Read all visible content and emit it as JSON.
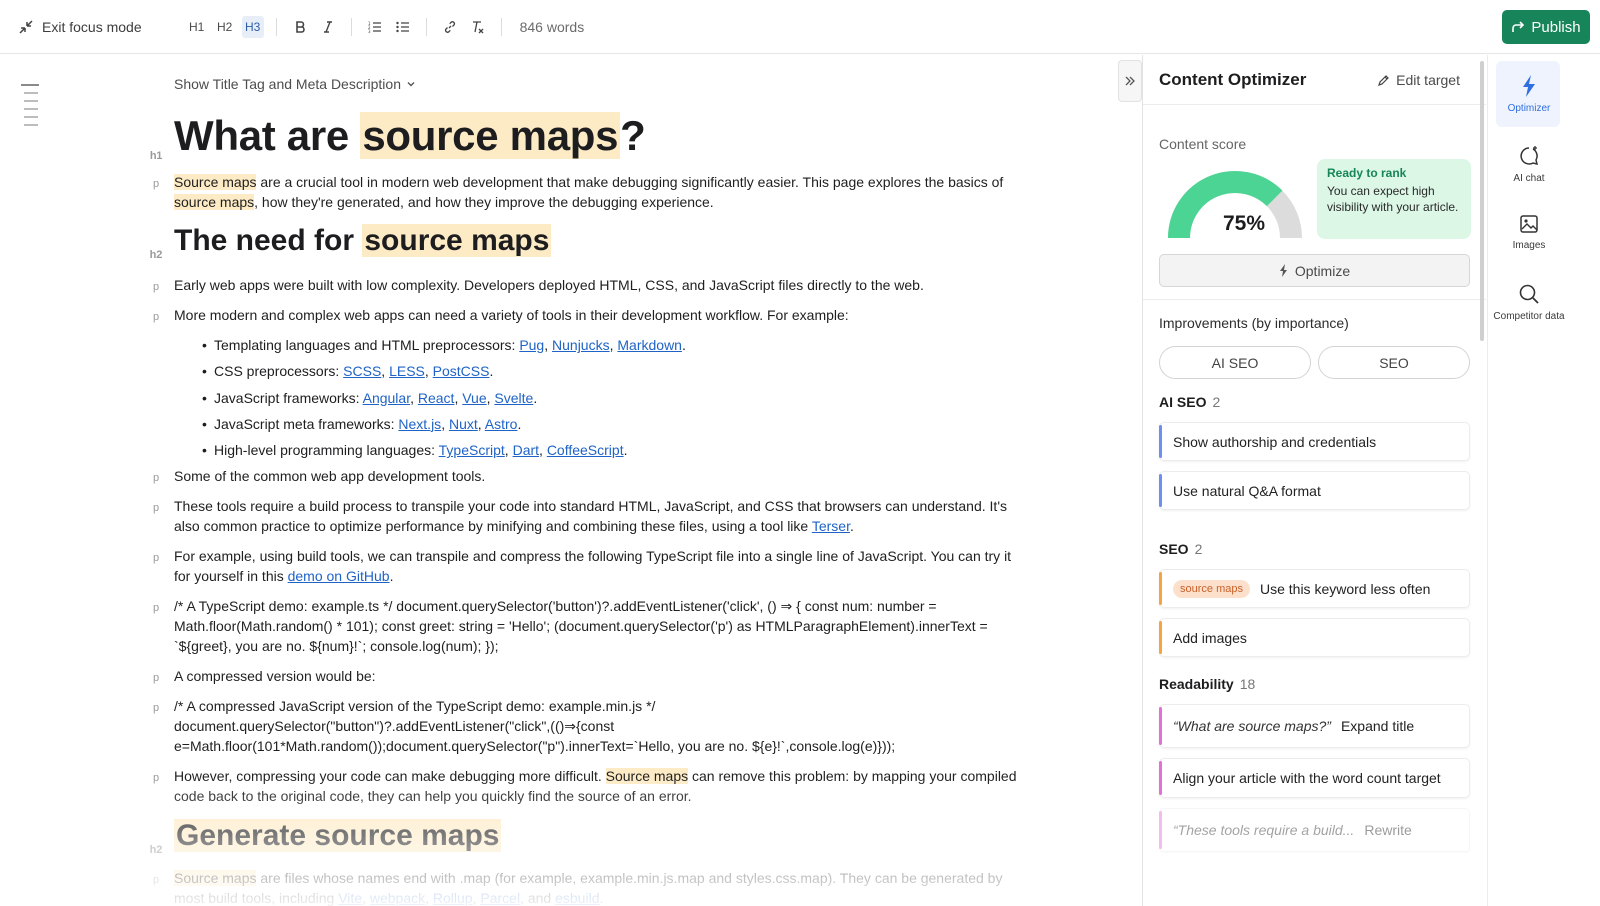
{
  "toolbar": {
    "exit_focus_label": "Exit focus mode",
    "heading_buttons": [
      "H1",
      "H2",
      "H3"
    ],
    "word_count": "846 words",
    "publish_label": "Publish"
  },
  "editor": {
    "show_title_label": "Show Title Tag and Meta Description",
    "tags": {
      "h1": "h1",
      "h2": "h2",
      "p": "p"
    },
    "h1_before": "What are ",
    "h1_keyword": "source maps",
    "h1_after": "?",
    "intro_kw1": "Source maps",
    "intro_text1": " are a crucial tool in modern web development that make debugging significantly easier. This page explores the basics of ",
    "intro_kw2": "source maps",
    "intro_text2": ", how they're generated, and how they improve the debugging experience.",
    "h2a_before": "The need for ",
    "h2a_keyword": "source maps",
    "p_early": "Early web apps were built with low complexity. Developers deployed HTML, CSS, and JavaScript files directly to the web.",
    "p_modern": "More modern and complex web apps can need a variety of tools in their development workflow. For example:",
    "bullets": [
      {
        "label": "Templating languages and HTML preprocessors: ",
        "links": [
          "Pug",
          "Nunjucks",
          "Markdown"
        ]
      },
      {
        "label": "CSS preprocessors: ",
        "links": [
          "SCSS",
          "LESS",
          "PostCSS"
        ]
      },
      {
        "label": "JavaScript frameworks: ",
        "links": [
          "Angular",
          "React",
          "Vue",
          "Svelte"
        ]
      },
      {
        "label": "JavaScript meta frameworks: ",
        "links": [
          "Next.js",
          "Nuxt",
          "Astro"
        ]
      },
      {
        "label": "High-level programming languages: ",
        "links": [
          "TypeScript",
          "Dart",
          "CoffeeScript"
        ]
      }
    ],
    "p_common": " Some of the common web app development tools.",
    "p_tools": "These tools require a build process to transpile your code into standard HTML, JavaScript, and CSS that browsers can understand. It's also common practice to optimize performance by minifying and combining these files, using a tool like ",
    "p_tools_link": "Terser",
    "p_example": "For example, using build tools, we can transpile and compress the following TypeScript file into a single line of JavaScript. You can try it for yourself in this ",
    "p_example_link": "demo on GitHub",
    "p_code1": "/* A TypeScript demo: example.ts */ document.querySelector('button')?.addEventListener('click', () ⇒ { const num: number = Math.floor(Math.random() * 101); const greet: string = 'Hello'; (document.querySelector('p') as HTMLParagraphElement).innerText = `${greet}, you are no. ${num}!`; console.log(num); });",
    "p_compressed": "A compressed version would be:",
    "p_code2": "/* A compressed JavaScript version of the TypeScript demo: example.min.js */ document.querySelector(\"button\")?.addEventListener(\"click\",(()⇒{const e=Math.floor(101*Math.random());document.querySelector(\"p\").innerText=`Hello, you are no. ${e}!`,console.log(e)}));",
    "p_however1": "However, compressing your code can make debugging more difficult. ",
    "p_however_kw": "Source maps",
    "p_however2": " can remove this problem: by mapping your compiled code back to the original code, they can help you quickly find the source of an error.",
    "h2b_keyword": "Generate source maps",
    "p_last_kw": "Source maps",
    "p_last_text": " are files whose names end with .map (for example, example.min.js.map and styles.css.map). They can be generated by most build tools, including ",
    "p_last_links": [
      "Vite",
      "webpack",
      "Rollup",
      "Parcel",
      "esbuild"
    ],
    "p_last_and": "and"
  },
  "panel": {
    "title": "Content Optimizer",
    "edit_target": "Edit target",
    "score_label": "Content score",
    "score": 75,
    "score_text": "75%",
    "rank_title": "Ready to rank",
    "rank_text": "You can expect high visibility with your article.",
    "optimize_label": "Optimize",
    "improvements_label": "Improvements (by importance)",
    "pills": [
      "AI SEO",
      "SEO"
    ],
    "ai_seo": {
      "title": "AI SEO",
      "count": "2",
      "items": [
        "Show authorship and credentials",
        "Use natural Q&A format"
      ]
    },
    "seo": {
      "title": "SEO",
      "count": "2",
      "keyword": "source maps",
      "keyword_item": "Use this keyword less often",
      "item2": "Add images"
    },
    "readability": {
      "title": "Readability",
      "count": "18",
      "quote1": "“What are source maps?”",
      "action1": "Expand title",
      "item2": "Align your article with the word count target",
      "quote3": "“These tools require a build...",
      "action3": "Rewrite"
    },
    "colors": {
      "accent_green": "#17845a",
      "gauge_green": "#4cd494",
      "gauge_gray": "#dcdcdc",
      "link_blue": "#1f63c6",
      "highlight": "#fdebc6"
    }
  },
  "rail": {
    "items": [
      "Optimizer",
      "AI chat",
      "Images",
      "Competitor data"
    ]
  }
}
